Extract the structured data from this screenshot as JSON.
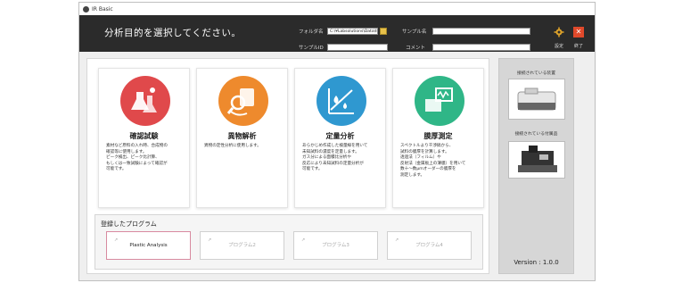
{
  "window": {
    "title": "IR Basic"
  },
  "header": {
    "headline": "分析目的を選択してください。",
    "folder_label": "フォルダ名",
    "folder_value": "C:\\¥Labsolutions\\Data\\IR",
    "sample_name_label": "サンプル名",
    "sample_name_value": "",
    "sample_id_label": "サンプルID",
    "sample_id_value": "",
    "comment_label": "コメント",
    "comment_value": "",
    "settings_label": "設定",
    "exit_label": "終了"
  },
  "cards": [
    {
      "title": "確認試験",
      "description": "素材など原料の入れ時、合成物の\n確認等に使用します。\nピーク検出、ピーク比計算、\nもしくは一致試験によって確認が\n可能です。",
      "color": "#e0494b",
      "icon": "flask-icon"
    },
    {
      "title": "異物解析",
      "description": "異物の定性分析に使用します。",
      "color": "#ee8a2d",
      "icon": "magnifier-hand-icon"
    },
    {
      "title": "定量分析",
      "description": "あらかじめ作成した検量線を用いて\n未知試料の濃度を定量します。\nガス分による面積比分析や\n反応により未知試料の定量分析が\n可能です。",
      "color": "#2f98d0",
      "icon": "drop-chart-icon"
    },
    {
      "title": "膜厚測定",
      "description": "スペクトルより干渉縞から、\n試料の膜厚を計算します。\n透過法（フィルム）や\n反射法（金属板上の薄膜）を用いて\n数十～数μmオーダーの膜厚を\n測定します。",
      "color": "#2fb687",
      "icon": "film-spectrum-icon"
    }
  ],
  "programs": {
    "title": "登録したプログラム",
    "items": [
      {
        "label": "Plastic Analysis",
        "active": true
      },
      {
        "label": "プログラム2",
        "active": false
      },
      {
        "label": "プログラム3",
        "active": false
      },
      {
        "label": "プログラム4",
        "active": false
      }
    ]
  },
  "sidebar": {
    "instrument_label": "接続されている装置",
    "accessory_label": "接続されている付属品",
    "version": "Version : 1.0.0"
  }
}
